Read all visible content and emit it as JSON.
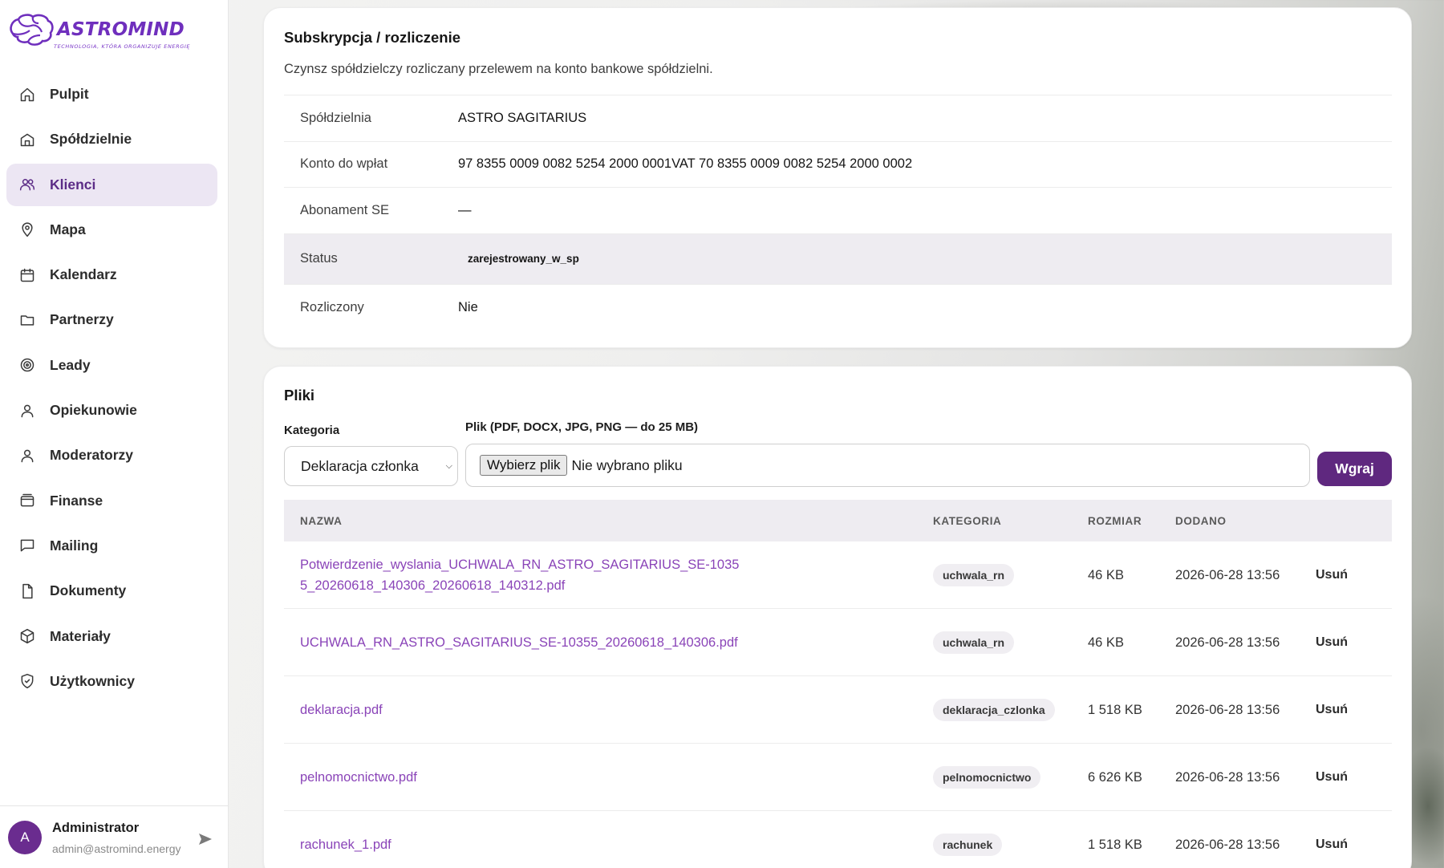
{
  "brand": {
    "name": "ASTROMIND",
    "tagline": "TECHNOLOGIA, KTÓRA ORGANIZUJE ENERGIĘ",
    "color": "#6f2fbd"
  },
  "sidebar": {
    "items": [
      {
        "label": "Pulpit",
        "icon": "home-icon"
      },
      {
        "label": "Spółdzielnie",
        "icon": "building-icon"
      },
      {
        "label": "Klienci",
        "icon": "users-icon",
        "active": true
      },
      {
        "label": "Mapa",
        "icon": "map-pin-icon"
      },
      {
        "label": "Kalendarz",
        "icon": "calendar-icon"
      },
      {
        "label": "Partnerzy",
        "icon": "folder-icon"
      },
      {
        "label": "Leady",
        "icon": "target-icon"
      },
      {
        "label": "Opiekunowie",
        "icon": "user-icon"
      },
      {
        "label": "Moderatorzy",
        "icon": "user-icon"
      },
      {
        "label": "Finanse",
        "icon": "wallet-icon"
      },
      {
        "label": "Mailing",
        "icon": "message-icon"
      },
      {
        "label": "Dokumenty",
        "icon": "file-icon"
      },
      {
        "label": "Materiały",
        "icon": "box-icon"
      },
      {
        "label": "Użytkownicy",
        "icon": "shield-icon"
      }
    ],
    "user": {
      "initial": "A",
      "name": "Administrator",
      "email": "admin@astromind.energy"
    }
  },
  "subscription": {
    "title": "Subskrypcja / rozliczenie",
    "description": "Czynsz spółdzielczy rozliczany przelewem na konto bankowe spółdzielni.",
    "rows": [
      {
        "key": "Spółdzielnia",
        "value": "ASTRO SAGITARIUS"
      },
      {
        "key": "Konto do wpłat",
        "value": "97 8355 0009 0082 5254 2000 0001VAT 70 8355 0009 0082 5254 2000 0002"
      },
      {
        "key": "Abonament SE",
        "value": "—"
      },
      {
        "key": "Status",
        "value": "zarejestrowany_w_sp"
      },
      {
        "key": "Rozliczony",
        "value": "Nie"
      }
    ]
  },
  "files": {
    "title": "Pliki",
    "category_label": "Kategoria",
    "category_value": "Deklaracja członka",
    "file_label": "Plik (PDF, DOCX, JPG, PNG — do 25 MB)",
    "file_button": "Wybierz plik",
    "file_status": "Nie wybrano pliku",
    "upload_button": "Wgraj",
    "columns": [
      "NAZWA",
      "KATEGORIA",
      "ROZMIAR",
      "DODANO"
    ],
    "delete_label": "Usuń",
    "rows": [
      {
        "name": "Potwierdzenie_wyslania_UCHWALA_RN_ASTRO_SAGITARIUS_SE-10355_20260618_140306_20260618_140312.pdf",
        "category": "uchwala_rn",
        "size": "46 KB",
        "added": "2026-06-28 13:56"
      },
      {
        "name": "UCHWALA_RN_ASTRO_SAGITARIUS_SE-10355_20260618_140306.pdf",
        "category": "uchwala_rn",
        "size": "46 KB",
        "added": "2026-06-28 13:56"
      },
      {
        "name": "deklaracja.pdf",
        "category": "deklaracja_czlonka",
        "size": "1 518 KB",
        "added": "2026-06-28 13:56"
      },
      {
        "name": "pelnomocnictwo.pdf",
        "category": "pelnomocnictwo",
        "size": "6 626 KB",
        "added": "2026-06-28 13:56"
      },
      {
        "name": "rachunek_1.pdf",
        "category": "rachunek",
        "size": "1 518 KB",
        "added": "2026-06-28 13:56"
      }
    ]
  }
}
